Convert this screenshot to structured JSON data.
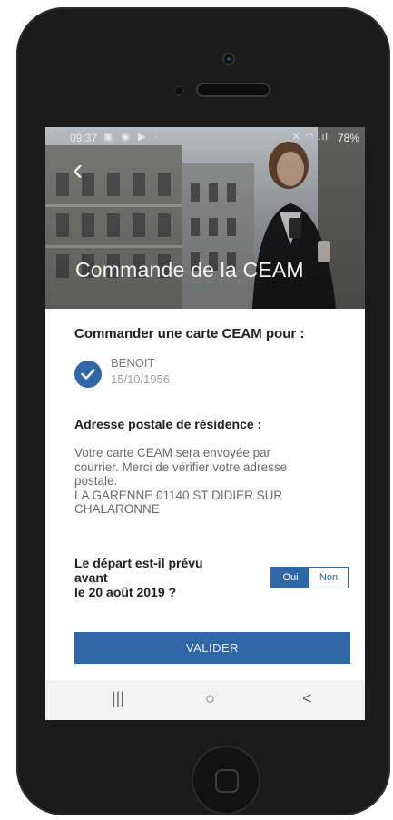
{
  "status_bar": {
    "time": "09:37",
    "left_icons": "▣ ◉ ▶ ·",
    "right_icons": "✕ ◠ .ıl",
    "battery": "78%"
  },
  "header": {
    "back_icon": "‹",
    "title": "Commande de la CEAM"
  },
  "main": {
    "heading": "Commander une carte CEAM pour :",
    "beneficiary": {
      "name": "BENOIT",
      "dob": "15/10/1956",
      "selected": true
    },
    "address_heading": "Adresse postale de résidence :",
    "address_text": [
      "Votre carte CEAM sera envoyée par",
      "courrier. Merci de vérifier votre adresse",
      "postale.",
      "LA GARENNE 01140 ST DIDIER SUR",
      "CHALARONNE"
    ],
    "departure_question": [
      "Le départ est-il prévu",
      "avant",
      "le 20 août 2019 ?"
    ],
    "toggle": {
      "yes": "Oui",
      "no": "Non",
      "selected": "Oui"
    },
    "submit_label": "VALIDER"
  },
  "nav_bar": {
    "recents": "|||",
    "home": "○",
    "back": "<"
  },
  "colors": {
    "accent": "#2f66a6",
    "phone_body": "#1b1b1b"
  }
}
